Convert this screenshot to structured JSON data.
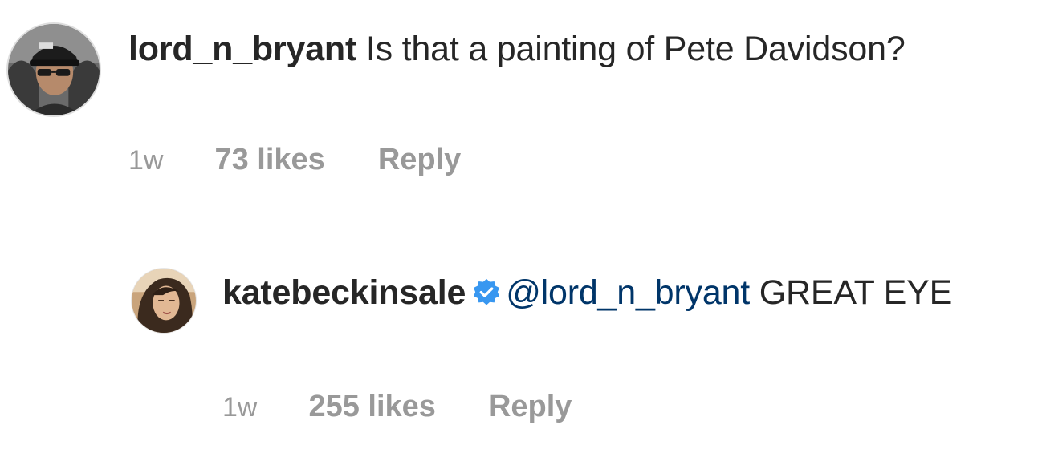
{
  "comments": [
    {
      "username": "lord_n_bryant",
      "verified": false,
      "mention": "",
      "text": " Is that a painting of Pete Davidson?",
      "time": "1w",
      "likes": "73 likes",
      "reply_label": "Reply"
    },
    {
      "username": "katebeckinsale",
      "verified": true,
      "mention": "@lord_n_bryant",
      "text": " GREAT EYE",
      "time": "1w",
      "likes": "255 likes",
      "reply_label": "Reply"
    }
  ],
  "colors": {
    "text": "#262626",
    "meta": "#999999",
    "mention": "#003569",
    "verified": "#3897f0"
  },
  "icons": {
    "verified": "verified-badge-icon"
  }
}
